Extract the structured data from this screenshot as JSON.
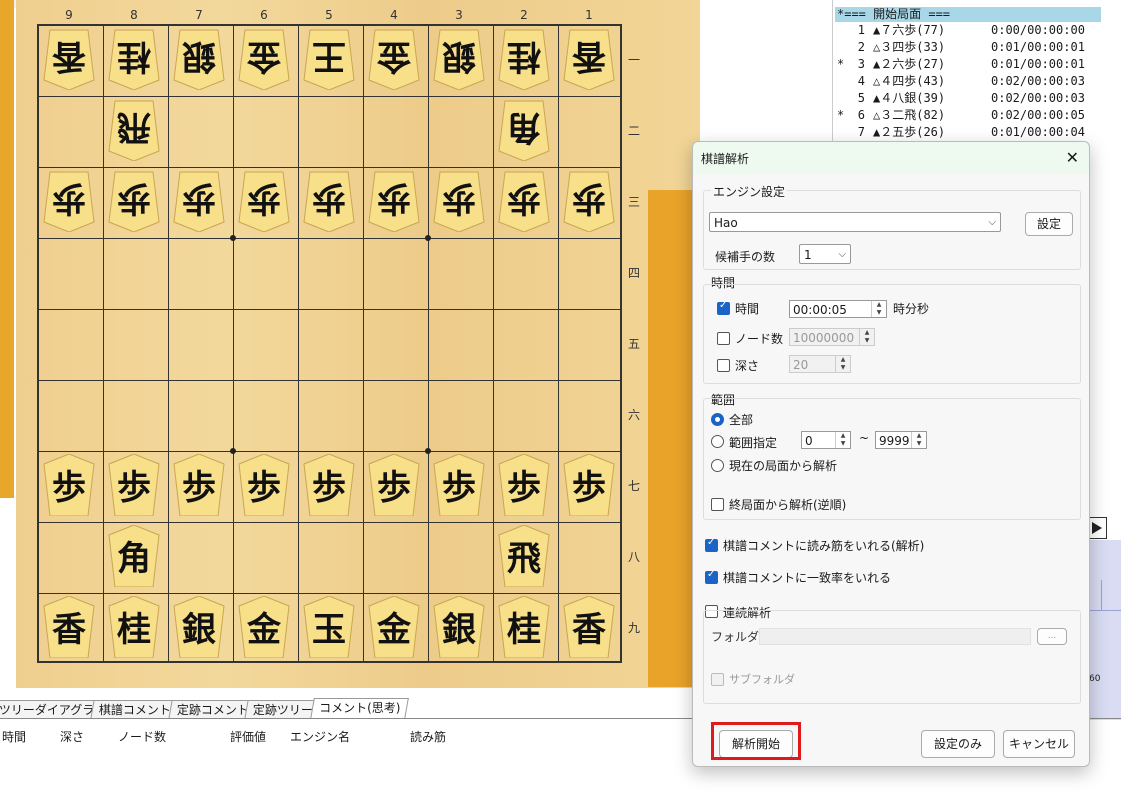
{
  "board": {
    "files": [
      "9",
      "8",
      "7",
      "6",
      "5",
      "4",
      "3",
      "2",
      "1"
    ],
    "ranks": [
      "一",
      "二",
      "三",
      "四",
      "五",
      "六",
      "七",
      "八",
      "九"
    ],
    "pieces": [
      {
        "file": 9,
        "rank": 1,
        "name": "香",
        "side": "gote"
      },
      {
        "file": 8,
        "rank": 1,
        "name": "桂",
        "side": "gote"
      },
      {
        "file": 7,
        "rank": 1,
        "name": "銀",
        "side": "gote"
      },
      {
        "file": 6,
        "rank": 1,
        "name": "金",
        "side": "gote"
      },
      {
        "file": 5,
        "rank": 1,
        "name": "王",
        "side": "gote"
      },
      {
        "file": 4,
        "rank": 1,
        "name": "金",
        "side": "gote"
      },
      {
        "file": 3,
        "rank": 1,
        "name": "銀",
        "side": "gote"
      },
      {
        "file": 2,
        "rank": 1,
        "name": "桂",
        "side": "gote"
      },
      {
        "file": 1,
        "rank": 1,
        "name": "香",
        "side": "gote"
      },
      {
        "file": 8,
        "rank": 2,
        "name": "飛",
        "side": "gote"
      },
      {
        "file": 2,
        "rank": 2,
        "name": "角",
        "side": "gote"
      },
      {
        "file": 9,
        "rank": 3,
        "name": "歩",
        "side": "gote"
      },
      {
        "file": 8,
        "rank": 3,
        "name": "歩",
        "side": "gote"
      },
      {
        "file": 7,
        "rank": 3,
        "name": "歩",
        "side": "gote"
      },
      {
        "file": 6,
        "rank": 3,
        "name": "歩",
        "side": "gote"
      },
      {
        "file": 5,
        "rank": 3,
        "name": "歩",
        "side": "gote"
      },
      {
        "file": 4,
        "rank": 3,
        "name": "歩",
        "side": "gote"
      },
      {
        "file": 3,
        "rank": 3,
        "name": "歩",
        "side": "gote"
      },
      {
        "file": 2,
        "rank": 3,
        "name": "歩",
        "side": "gote"
      },
      {
        "file": 1,
        "rank": 3,
        "name": "歩",
        "side": "gote"
      },
      {
        "file": 9,
        "rank": 7,
        "name": "歩",
        "side": "sente"
      },
      {
        "file": 8,
        "rank": 7,
        "name": "歩",
        "side": "sente"
      },
      {
        "file": 7,
        "rank": 7,
        "name": "歩",
        "side": "sente"
      },
      {
        "file": 6,
        "rank": 7,
        "name": "歩",
        "side": "sente"
      },
      {
        "file": 5,
        "rank": 7,
        "name": "歩",
        "side": "sente"
      },
      {
        "file": 4,
        "rank": 7,
        "name": "歩",
        "side": "sente"
      },
      {
        "file": 3,
        "rank": 7,
        "name": "歩",
        "side": "sente"
      },
      {
        "file": 2,
        "rank": 7,
        "name": "歩",
        "side": "sente"
      },
      {
        "file": 1,
        "rank": 7,
        "name": "歩",
        "side": "sente"
      },
      {
        "file": 8,
        "rank": 8,
        "name": "角",
        "side": "sente"
      },
      {
        "file": 2,
        "rank": 8,
        "name": "飛",
        "side": "sente"
      },
      {
        "file": 9,
        "rank": 9,
        "name": "香",
        "side": "sente"
      },
      {
        "file": 8,
        "rank": 9,
        "name": "桂",
        "side": "sente"
      },
      {
        "file": 7,
        "rank": 9,
        "name": "銀",
        "side": "sente"
      },
      {
        "file": 6,
        "rank": 9,
        "name": "金",
        "side": "sente"
      },
      {
        "file": 5,
        "rank": 9,
        "name": "玉",
        "side": "sente"
      },
      {
        "file": 4,
        "rank": 9,
        "name": "金",
        "side": "sente"
      },
      {
        "file": 3,
        "rank": 9,
        "name": "銀",
        "side": "sente"
      },
      {
        "file": 2,
        "rank": 9,
        "name": "桂",
        "side": "sente"
      },
      {
        "file": 1,
        "rank": 9,
        "name": "香",
        "side": "sente"
      }
    ]
  },
  "kifu": {
    "header": "*=== 開始局面 ===",
    "moves": [
      {
        "mark": "",
        "num": "1",
        "move": "▲７六歩(77)",
        "time": "0:00/00:00:00"
      },
      {
        "mark": "",
        "num": "2",
        "move": "△３四歩(33)",
        "time": "0:01/00:00:01"
      },
      {
        "mark": "*",
        "num": "3",
        "move": "▲２六歩(27)",
        "time": "0:01/00:00:01"
      },
      {
        "mark": "",
        "num": "4",
        "move": "△４四歩(43)",
        "time": "0:02/00:00:03"
      },
      {
        "mark": "",
        "num": "5",
        "move": "▲４八銀(39)",
        "time": "0:02/00:00:03"
      },
      {
        "mark": "*",
        "num": "6",
        "move": "△３二飛(82)",
        "time": "0:02/00:00:05"
      },
      {
        "mark": "",
        "num": "7",
        "move": "▲２五歩(26)",
        "time": "0:01/00:00:04"
      }
    ]
  },
  "tabs": [
    "ツリーダイアグラム",
    "棋譜コメント",
    "定跡コメント",
    "定跡ツリー",
    "コメント(思考)"
  ],
  "columns": [
    "時間",
    "深さ",
    "ノード数",
    "評価値",
    "エンジン名",
    "読み筋"
  ],
  "dialog": {
    "title": "棋譜解析",
    "engine_group": "エンジン設定",
    "engine_value": "Hao",
    "settings_button": "設定",
    "candidates_label": "候補手の数",
    "candidates_value": "1",
    "time_group": "時間",
    "time_label": "時間",
    "time_value": "00:00:05",
    "time_unit": "時分秒",
    "nodes_label": "ノード数",
    "nodes_value": "10000000",
    "depth_label": "深さ",
    "depth_value": "20",
    "range_group": "範囲",
    "range_all": "全部",
    "range_specify": "範囲指定",
    "range_from": "0",
    "range_tilde": "~",
    "range_to": "9999",
    "range_current": "現在の局面から解析",
    "reverse_label": "終局面から解析(逆順)",
    "comment_pv_label": "棋譜コメントに読み筋をいれる(解析)",
    "comment_match_label": "棋譜コメントに一致率をいれる",
    "continuous_label": "連続解析",
    "folder_label": "フォルダ",
    "browse_label": "...",
    "subfolder_label": "サブフォルダ",
    "start_button": "解析開始",
    "settings_only_button": "設定のみ",
    "cancel_button": "キャンセル"
  },
  "side_value": "60",
  "colors": {
    "accent": "#1a64c8",
    "highlight": "#e01a1a",
    "piece": "#f8df8a",
    "board": "#f0d190"
  }
}
